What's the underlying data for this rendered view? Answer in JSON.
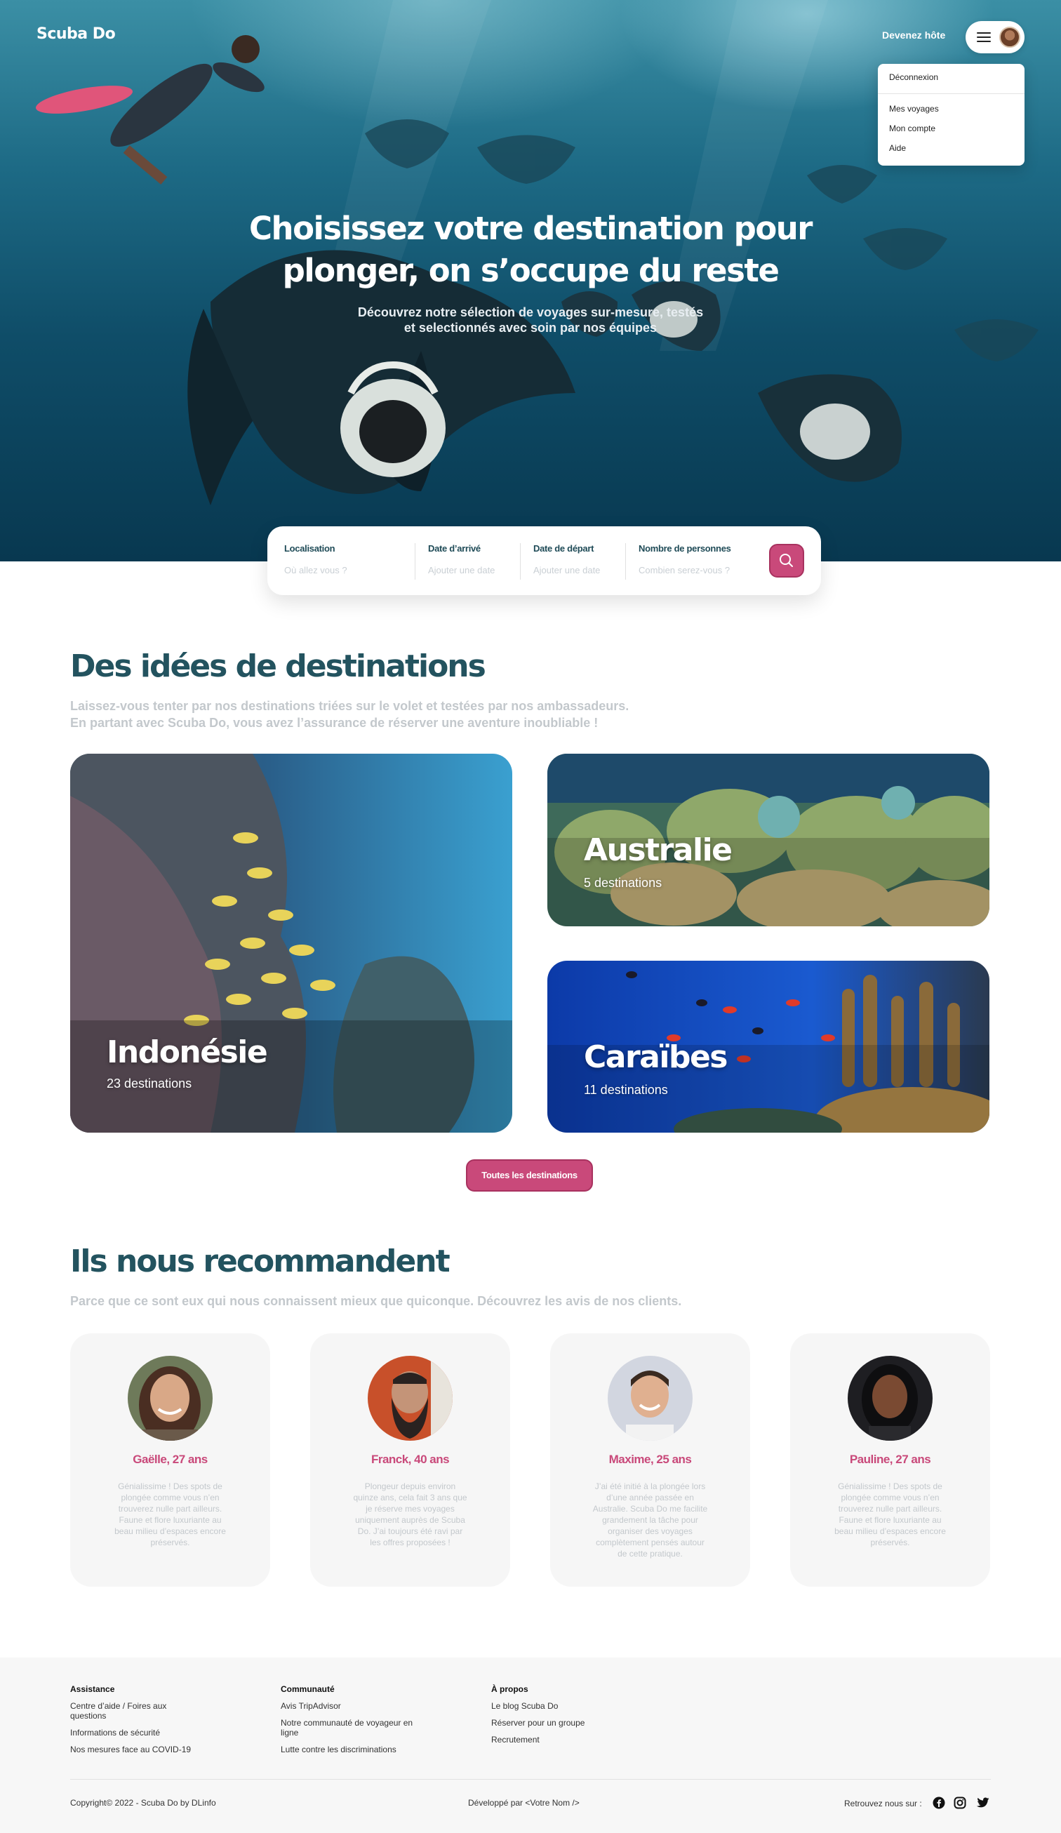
{
  "header": {
    "brand": "Scuba Do",
    "host_link": "Devenez hôte",
    "menu": {
      "logout": "Déconnexion",
      "items": [
        "Mes voyages",
        "Mon compte",
        "Aide"
      ]
    }
  },
  "hero": {
    "title_line1": "Choisissez votre destination pour",
    "title_line2": "plonger, on s’occupe du reste",
    "subtitle_line1": "Découvrez notre sélection de voyages sur-mesure, testés",
    "subtitle_line2": "et selectionnés avec soin par nos équipes"
  },
  "search": {
    "fields": [
      {
        "label": "Localisation",
        "placeholder": "Où allez vous ?"
      },
      {
        "label": "Date d’arrivé",
        "placeholder": "Ajouter une date"
      },
      {
        "label": "Date de départ",
        "placeholder": "Ajouter une date"
      },
      {
        "label": "Nombre de personnes",
        "placeholder": "Combien serez-vous ?"
      }
    ],
    "button_icon": "search-icon"
  },
  "destinations": {
    "title": "Des idées de destinations",
    "lead_line1": "Laissez-vous tenter par nos destinations triées sur le volet et testées par nos ambassadeurs.",
    "lead_line2": "En partant avec Scuba Do, vous avez l’assurance de réserver une aventure inoubliable !",
    "cards": [
      {
        "name": "Indonésie",
        "count": "23 destinations"
      },
      {
        "name": "Australie",
        "count": "5 destinations"
      },
      {
        "name": "Caraïbes",
        "count": "11 destinations"
      }
    ],
    "all_button": "Toutes les destinations"
  },
  "testimonials": {
    "title": "Ils nous recommandent",
    "lead": "Parce que ce sont eux qui nous connaissent mieux que quiconque. Découvrez les avis de nos clients.",
    "items": [
      {
        "name": "Gaëlle, 27 ans",
        "text": "Génialissime ! Des spots de plongée comme vous n’en trouverez nulle part ailleurs. Faune et flore luxuriante au beau milieu d’espaces encore préservés."
      },
      {
        "name": "Franck, 40 ans",
        "text": "Plongeur depuis environ quinze ans, cela fait 3 ans que je réserve mes voyages uniquement auprès de Scuba Do. J’ai toujours été ravi par les offres proposées !"
      },
      {
        "name": "Maxime, 25 ans",
        "text": "J’ai été initié à la plongée lors d’une année passée en Australie. Scuba Do me facilite grandement la tâche pour organiser des voyages complètement pensés autour de cette pratique."
      },
      {
        "name": "Pauline, 27 ans",
        "text": "Génialissime ! Des spots de plongée comme vous n’en trouverez nulle part ailleurs. Faune et flore luxuriante au beau milieu d’espaces encore préservés."
      }
    ]
  },
  "footer": {
    "columns": [
      {
        "title": "Assistance",
        "links": [
          "Centre d’aide / Foires aux questions",
          "Informations de sécurité",
          "Nos mesures face au COVID-19"
        ]
      },
      {
        "title": "Communauté",
        "links": [
          "Avis TripAdvisor",
          "Notre communauté de voyageur en ligne",
          "Lutte contre les discriminations"
        ]
      },
      {
        "title": "À propos",
        "links": [
          "Le blog Scuba Do",
          "Réserver pour un groupe",
          "Recrutement"
        ]
      }
    ],
    "copyright": "Copyright© 2022 - Scuba Do by DLinfo",
    "developed": "Développé par <Votre Nom />",
    "follow": "Retrouvez nous sur :",
    "social_icons": [
      "facebook-icon",
      "instagram-icon",
      "twitter-icon"
    ]
  },
  "colors": {
    "accent": "#c9497a",
    "heading": "#23535f",
    "muted": "#c3c8cc"
  }
}
